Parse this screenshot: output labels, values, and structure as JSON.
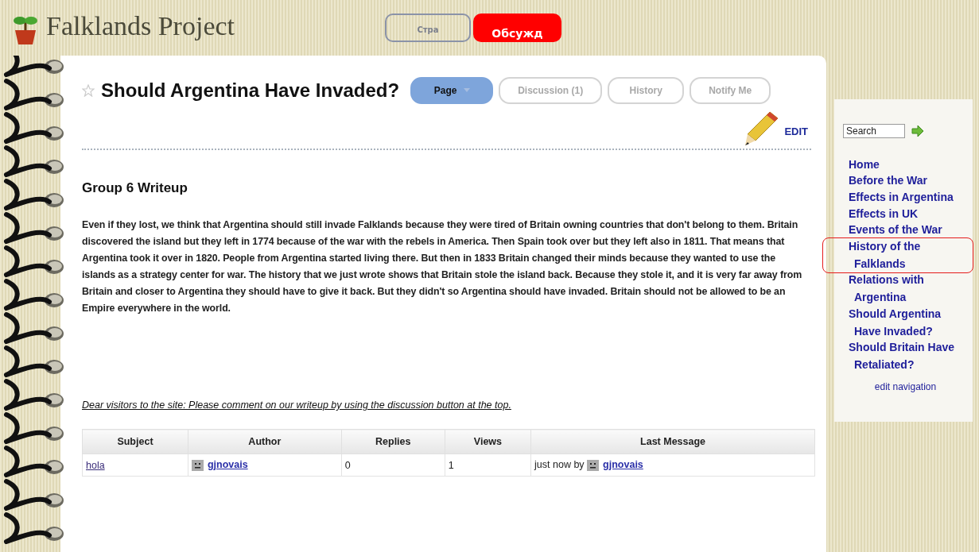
{
  "site": {
    "title": "Falklands Project"
  },
  "overlay_buttons": [
    {
      "label": "Стра",
      "kind": "outline"
    },
    {
      "label": "Обсужд",
      "kind": "filled"
    }
  ],
  "page": {
    "title": "Should Argentina Have Invaded?",
    "tabs": [
      {
        "label": "Page",
        "selected": true,
        "dropdown": true
      },
      {
        "label": "Discussion (1)",
        "selected": false,
        "dropdown": false
      },
      {
        "label": "History",
        "selected": false,
        "dropdown": false
      },
      {
        "label": "Notify Me",
        "selected": false,
        "dropdown": false
      }
    ],
    "edit_label": "EDIT",
    "heading": "Group 6 Writeup",
    "body": "Even if they lost, we think that Argentina should still invade Falklands because they were tired of Britain owning countries that don't belong to them. Britain discovered the island but they left in 1774 because of the war with the rebels in America. Then Spain took over but they left also in 1811. That means that Argentina took it over in 1820. People from Argentina started living there. But then in 1833 Britain changed their minds because they wanted to use the islands as a strategy center for war. The history that we just wrote shows that Britain stole the island back. Because they stole it, and it is very far away from Britain and closer to Argentina they should have to give it back. But they didn't so Argentina should have invaded. Britain should not be allowed to be an Empire everywhere in the world.",
    "notice": "Dear visitors to the site: Please comment on our writeup by using the discussion button at the top.",
    "table": {
      "columns": [
        "Subject",
        "Author",
        "Replies",
        "Views",
        "Last Message"
      ],
      "rows": [
        {
          "subject": "hola",
          "author": "gjnovais",
          "replies": "0",
          "views": "1",
          "last_message": "just now by",
          "last_author": "gjnovais"
        }
      ]
    }
  },
  "sidebar": {
    "search": {
      "value": "Search"
    },
    "nav": [
      {
        "label": "Home",
        "highlighted": false
      },
      {
        "label": "Before the War",
        "highlighted": false
      },
      {
        "label": "Effects in Argentina",
        "highlighted": false
      },
      {
        "label": "Effects in UK",
        "highlighted": false
      },
      {
        "label": "Events of the War",
        "highlighted": false
      },
      {
        "label": "History of the Falklands",
        "highlighted": true
      },
      {
        "label": "Relations with Argentina",
        "highlighted": false
      },
      {
        "label": "Should Argentina Have Invaded?",
        "highlighted": false
      },
      {
        "label": "Should Britain Have Retaliated?",
        "highlighted": false
      }
    ],
    "edit_link": "edit navigation"
  }
}
